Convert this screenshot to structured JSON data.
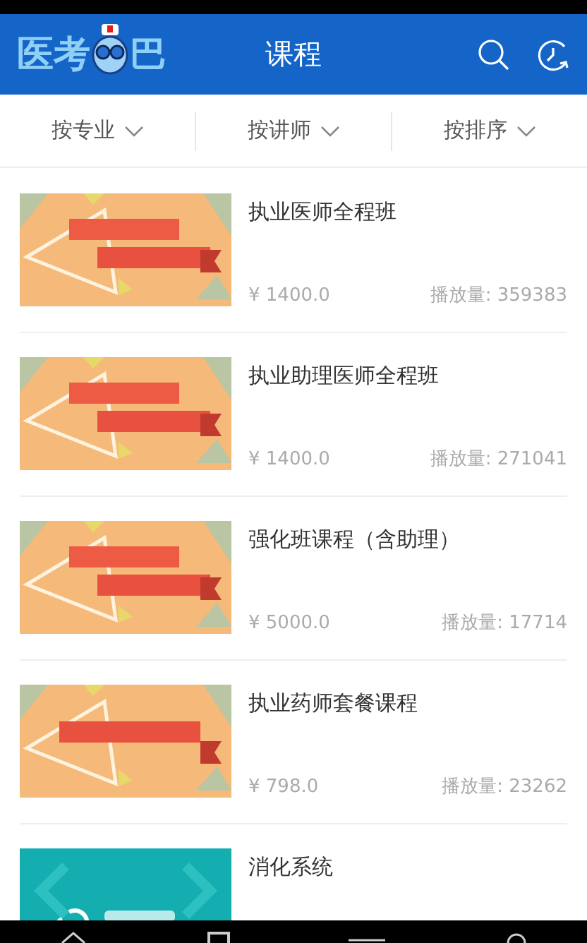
{
  "header": {
    "logo": {
      "left": "医考",
      "right": "巴"
    },
    "title": "课程"
  },
  "filters": [
    {
      "label": "按专业"
    },
    {
      "label": "按讲师"
    },
    {
      "label": "按排序"
    }
  ],
  "courses": [
    {
      "title": "执业医师全程班",
      "price": "¥ 1400.0",
      "plays": "播放量: 359383",
      "thumb": {
        "kind": "double"
      }
    },
    {
      "title": "执业助理医师全程班",
      "price": "¥ 1400.0",
      "plays": "播放量: 271041",
      "thumb": {
        "kind": "double"
      }
    },
    {
      "title": "强化班课程（含助理）",
      "price": "¥ 5000.0",
      "plays": "播放量: 17714",
      "thumb": {
        "kind": "double"
      }
    },
    {
      "title": "执业药师套餐课程",
      "price": "¥ 798.0",
      "plays": "播放量: 23262",
      "thumb": {
        "kind": "single"
      }
    },
    {
      "title": "消化系统",
      "thumb": {
        "kind": "teal"
      }
    }
  ]
}
